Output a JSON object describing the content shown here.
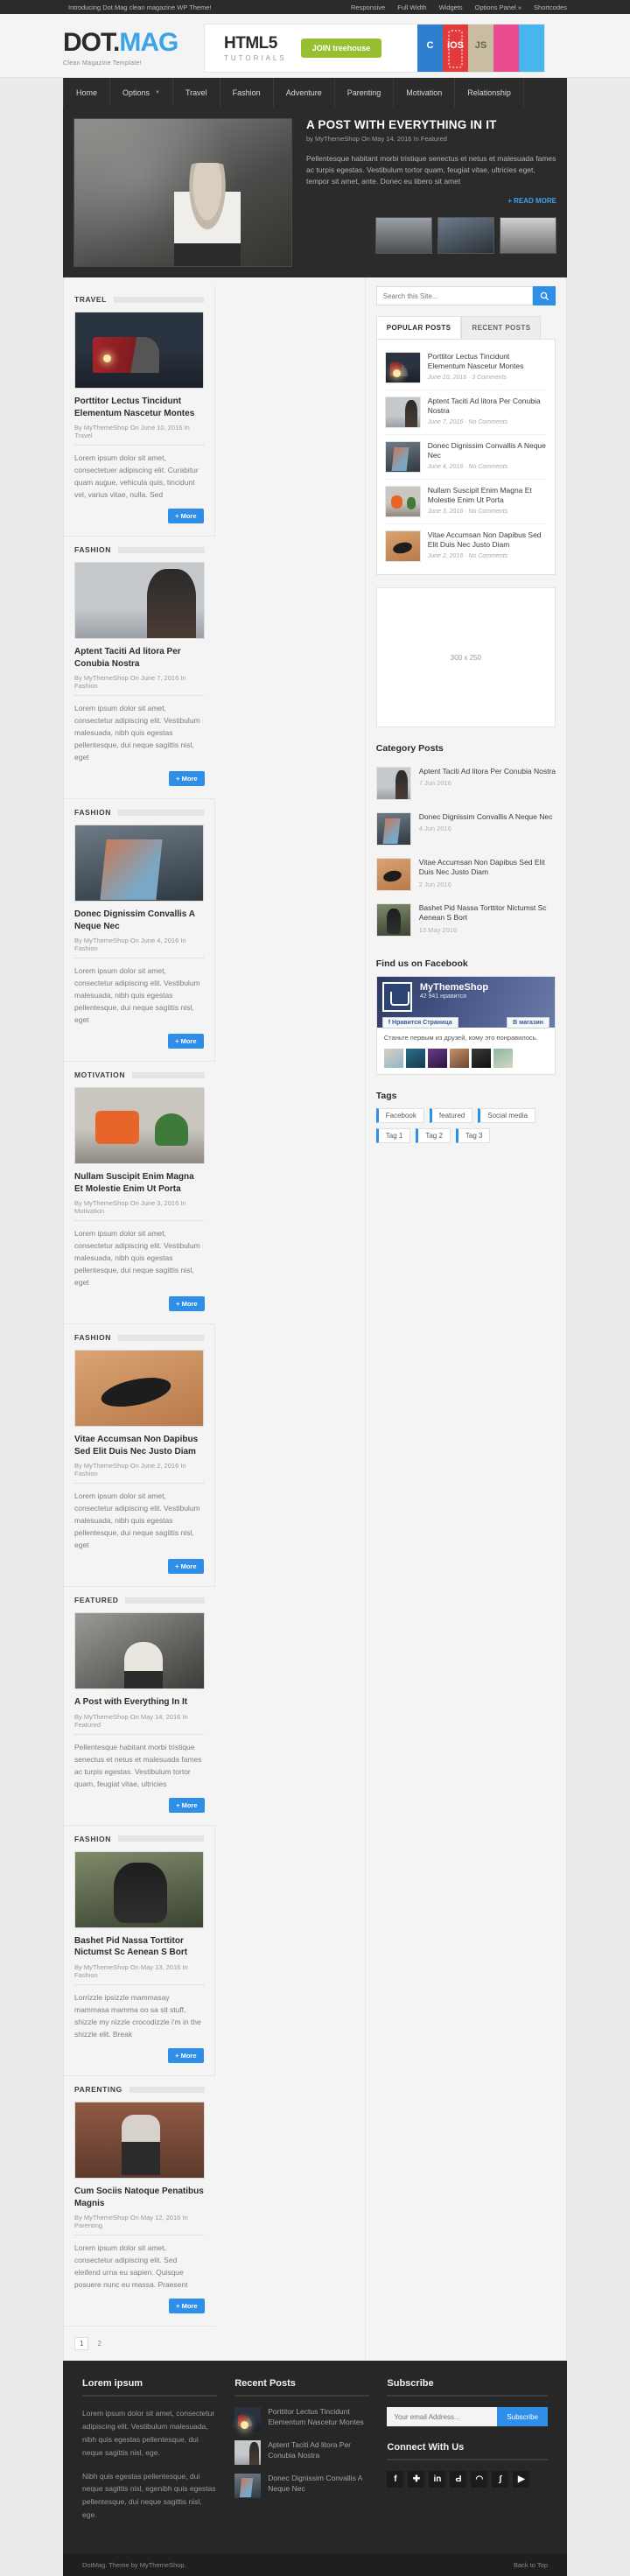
{
  "topbar": {
    "intro": "Introducing Dot.Mag clean magazine WP Theme!",
    "links": [
      "Responsive",
      "Full Width",
      "Widgets",
      "Options Panel »",
      "Shortcodes"
    ]
  },
  "header": {
    "logo_dot": "DOT.",
    "logo_mag": "MAG",
    "tagline": "Clean Magazine Template!",
    "banner": {
      "title": "HTML5",
      "subtitle": "TUTORIALS",
      "cta": "JOIN treehouse",
      "icons": [
        "C",
        "iOS",
        "JS",
        "",
        ""
      ]
    }
  },
  "nav": {
    "items": [
      {
        "label": "Home",
        "caret": ""
      },
      {
        "label": "Options",
        "caret": "▼"
      },
      {
        "label": "Travel",
        "caret": ""
      },
      {
        "label": "Fashion",
        "caret": ""
      },
      {
        "label": "Adventure",
        "caret": ""
      },
      {
        "label": "Parenting",
        "caret": ""
      },
      {
        "label": "Motivation",
        "caret": ""
      },
      {
        "label": "Relationship",
        "caret": ""
      }
    ]
  },
  "slider": {
    "title": "A POST WITH EVERYTHING IN IT",
    "meta": "by MyThemeShop On May 14, 2016 In Featured",
    "excerpt": "Pellentesque habitant morbi tristique senectus et netus et malesuada fames ac turpis egestas. Vestibulum tortor quam, feugiat vitae, ultricies eget, tempor sit amet, ante. Donec eu libero sit amet",
    "read_more": "+ READ MORE"
  },
  "posts": [
    {
      "category": "TRAVEL",
      "title": "Porttitor Lectus Tincidunt Elementum Nascetur Montes",
      "meta": "By MyThemeShop On June 10, 2016 In Travel",
      "excerpt": "Lorem ipsum dolor sit amet, consectetuer adipiscing elit. Curabitur quam augue, vehicula quis, tincidunt vel, varius vitae, nulla. Sed",
      "more": "+ More",
      "thumb": "t-train"
    },
    {
      "category": "FASHION",
      "title": "Aptent Taciti Ad litora Per Conubia Nostra",
      "meta": "By MyThemeShop On June 7, 2016 In Fashion",
      "excerpt": "Lorem ipsum dolor sit amet, consectetur adipiscing elit. Vestibulum malesuada, nibh quis egestas pellentesque, dui neque sagittis nisl, eget",
      "more": "+ More",
      "thumb": "t-fashion"
    },
    {
      "category": "FASHION",
      "title": "Donec Dignissim Convallis A Neque Nec",
      "meta": "By MyThemeShop On June 4, 2016 In Fashion",
      "excerpt": "Lorem ipsum dolor sit amet, consectetur adipiscing elit. Vestibulum malesuada, nibh quis egestas pellentesque, dui neque sagittis nisl, eget",
      "more": "+ More",
      "thumb": "t-wall"
    },
    {
      "category": "MOTIVATION",
      "title": "Nullam Suscipit Enim Magna Et Molestie Enim Ut Porta",
      "meta": "By MyThemeShop On June 3, 2016 In Motivation",
      "excerpt": "Lorem ipsum dolor sit amet, consectetur adipiscing elit. Vestibulum malesuada, nibh quis egestas pellentesque, dui neque sagittis nisl, eget",
      "more": "+ More",
      "thumb": "t-can"
    },
    {
      "category": "FASHION",
      "title": "Vitae Accumsan Non Dapibus Sed Elit Duis Nec Justo Diam",
      "meta": "By MyThemeShop On June 2, 2016 In Fashion",
      "excerpt": "Lorem ipsum dolor sit amet, consectetur adipiscing elit. Vestibulum malesuada, nibh quis egestas pellentesque, dui neque sagittis nisl, eget",
      "more": "+ More",
      "thumb": "t-sand"
    },
    {
      "category": "FEATURED",
      "title": "A Post with Everything In It",
      "meta": "By MyThemeShop On May 14, 2016 In Featured",
      "excerpt": "Pellentesque habitant morbi tristique senectus et netus et malesuada fames ac turpis egestas. Vestibulum tortor quam, feugiat vitae, ultricies",
      "more": "+ More",
      "thumb": "t-kid2"
    },
    {
      "category": "FASHION",
      "title": "Bashet Pid Nassa Torttitor Nictumst Sc Aenean S Bort",
      "meta": "By MyThemeShop On May 13, 2016 In Fashion",
      "excerpt": "Lorrizzle ipsizzle mammasay mammasa mamma oo sa sit stuff, shizzle my nizzle crocodizzle i'm in the shizzle elit. Break",
      "more": "+ More",
      "thumb": "t-dog"
    },
    {
      "category": "PARENTING",
      "title": "Cum Sociis Natoque Penatibus Magnis",
      "meta": "By MyThemeShop On May 12, 2016 In Parenting",
      "excerpt": "Lorem ipsum dolor sit amet, consectetur adipiscing elit. Sed eleifend urna eu sapien. Quisque posuere nunc eu massa. Praesent",
      "more": "+ More",
      "thumb": "t-brick"
    }
  ],
  "pagination": {
    "pages": [
      "1",
      "2"
    ]
  },
  "sidebar": {
    "search": {
      "placeholder": "Search this Site...",
      "icon": "search-icon"
    },
    "tabs": [
      {
        "label": "POPULAR POSTS",
        "active": true
      },
      {
        "label": "RECENT POSTS",
        "active": false
      }
    ],
    "popular_posts": [
      {
        "title": "Porttitor Lectus Tincidunt Elementum Nascetur Montes",
        "meta": "June 10, 2016 · 3 Comments",
        "thumb": "t-train"
      },
      {
        "title": "Aptent Taciti Ad litora Per Conubia Nostra",
        "meta": "June 7, 2016 · No Comments",
        "thumb": "t-fashion"
      },
      {
        "title": "Donec Dignissim Convallis A Neque Nec",
        "meta": "June 4, 2016 · No Comments",
        "thumb": "t-wall"
      },
      {
        "title": "Nullam Suscipit Enim Magna Et Molestie Enim Ut Porta",
        "meta": "June 3, 2016 · No Comments",
        "thumb": "t-can"
      },
      {
        "title": "Vitae Accumsan Non Dapibus Sed Elit Duis Nec Justo Diam",
        "meta": "June 2, 2016 · No Comments",
        "thumb": "t-sand"
      }
    ],
    "ad": {
      "label": "300 x 250"
    },
    "category_posts_heading": "Category Posts",
    "category_posts": [
      {
        "title": "Aptent Taciti Ad litora Per Conubia Nostra",
        "date": "7 Jun 2016",
        "thumb": "t-fashion"
      },
      {
        "title": "Donec Dignissim Convallis A Neque Nec",
        "date": "4 Jun 2016",
        "thumb": "t-wall"
      },
      {
        "title": "Vitae Accumsan Non Dapibus Sed Elit Duis Nec Justo Diam",
        "date": "2 Jun 2016",
        "thumb": "t-sand"
      },
      {
        "title": "Bashet Pid Nassa Torttitor Nictumst Sc Aenean S Bort",
        "date": "13 May 2016",
        "thumb": "t-dog"
      }
    ],
    "facebook_heading": "Find us on Facebook",
    "facebook": {
      "page_name": "MyThemeShop",
      "likes": "42 941 нравится",
      "like_button": "Нравится Страница",
      "share_button": "В магазин",
      "social_text": "Станьте первым из друзей, кому это понравилось."
    },
    "tags_heading": "Tags",
    "tags": [
      "Facebook",
      "featured",
      "Social media",
      "Tag 1",
      "Tag 2",
      "Tag 3"
    ]
  },
  "footer": {
    "col1": {
      "heading": "Lorem ipsum",
      "p1": "Lorem ipsum dolor sit amet, consectetur adipiscing elit. Vestibulum malesuada, nibh quis egestas pellentesque, dui neque sagittis nisl, ege.",
      "p2": "Nibh quis egestas pellentesque, dui neque sagittis nisl, egenibh quis egestas pellentesque, dui neque sagittis nisl, ege."
    },
    "col2": {
      "heading": "Recent Posts",
      "items": [
        {
          "title": "Porttitor Lectus Tincidunt Elementum Nascetur Montes",
          "thumb": "t-train"
        },
        {
          "title": "Aptent Taciti Ad litora Per Conubia Nostra",
          "thumb": "t-fashion"
        },
        {
          "title": "Donec Dignissim Convallis A Neque Nec",
          "thumb": "t-wall"
        }
      ]
    },
    "col3": {
      "heading": "Subscribe",
      "email_placeholder": "Your email Address...",
      "subscribe_label": "Subscribe",
      "connect_heading": "Connect With Us",
      "socials": [
        {
          "name": "facebook-icon",
          "glyph": "f"
        },
        {
          "name": "googleplus-icon",
          "glyph": "✚"
        },
        {
          "name": "linkedin-icon",
          "glyph": "in"
        },
        {
          "name": "pinterest-icon",
          "glyph": "Ԁ"
        },
        {
          "name": "rss-icon",
          "glyph": "◠"
        },
        {
          "name": "stumbleupon-icon",
          "glyph": "∫"
        },
        {
          "name": "youtube-icon",
          "glyph": "▶"
        }
      ]
    }
  },
  "bottombar": {
    "copyright": "DotMag. Theme by MyThemeShop.",
    "back_to_top": "Back to Top"
  },
  "colors": {
    "accent": "#2f8fe8",
    "dark": "#2b2b2b",
    "logo_blue": "#3ba3e8",
    "green": "#97bf31"
  }
}
